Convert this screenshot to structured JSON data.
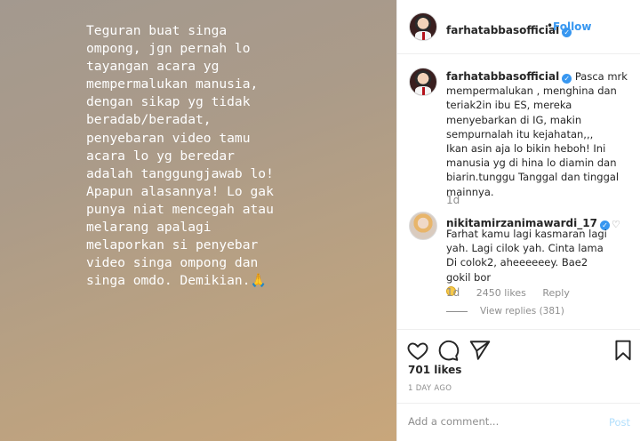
{
  "media": {
    "text": "Teguran buat singa\nompong, jgn pernah lo\ntayangan acara yg\nmempermalukan manusia,\ndengan sikap yg tidak\nberadab/beradat,\npenyebaran video tamu\nacara lo yg beredar\nadalah tanggungjawab lo!\nApapun alasannya! Lo gak\npunya niat mencegah atau\nmelarang apalagi\nmelaporkan si penyebar\nvideo singa ompong dan\nsinga omdo. Demikian.🙏"
  },
  "header": {
    "username": "farhatabbasofficial",
    "dot": "•",
    "follow_label": "Follow"
  },
  "caption": {
    "username": "farhatabbasofficial",
    "para1": "Pasca mrk mempermalukan , menghina dan teriak2in ibu ES, mereka menyebarkan di IG, makin sempurnalah itu kejahatan,,,",
    "para2": "Ikan asin aja lo bikin heboh! Ini manusia yg di hina lo diamin dan biarin.tunggu Tanggal dan tinggal mainnya.",
    "time": "1d"
  },
  "comment": {
    "username": "nikitamirzanimawardi_17",
    "text": "Farhat kamu lagi kasmaran lagi yah. Lagi cilok yah. Cinta lama Di colok2, aheeeeeey. Bae2 gokil bor",
    "time": "1d",
    "likes": "2450 likes",
    "reply_label": "Reply",
    "view_replies": "View replies (381)"
  },
  "post": {
    "likes": "701 likes",
    "ago": "1 DAY AGO"
  },
  "add_comment": {
    "placeholder": "Add a comment...",
    "post_label": "Post"
  },
  "colors": {
    "accent": "#3897f0",
    "muted": "#8e8e8e"
  }
}
